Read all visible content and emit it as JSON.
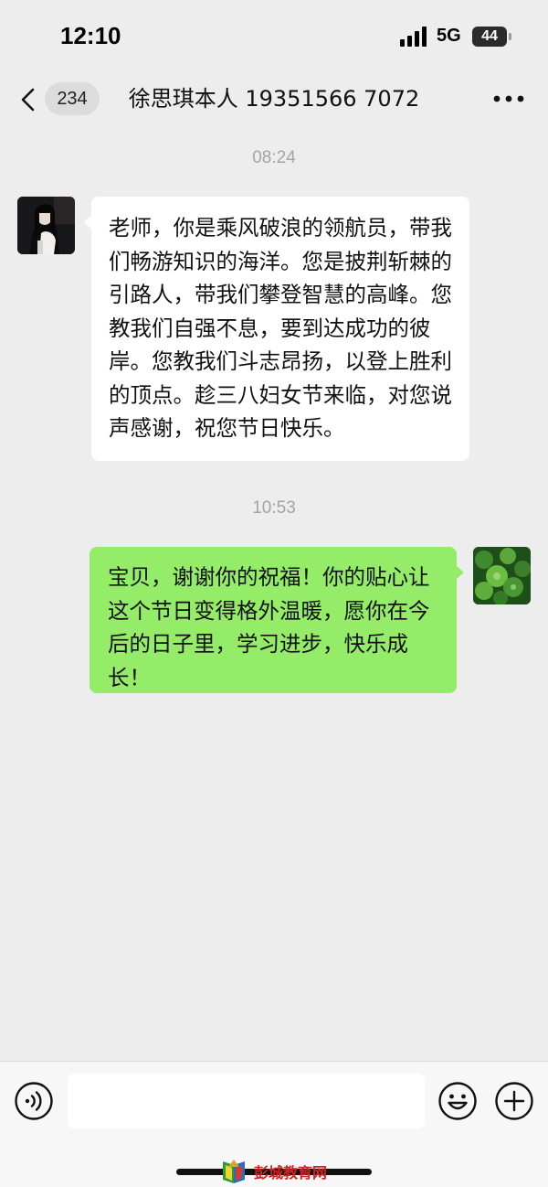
{
  "status_bar": {
    "time": "12:10",
    "network": "5G",
    "battery": "44",
    "battery_level_percent": 44
  },
  "header": {
    "unread_count": "234",
    "title": "徐思琪本人 19351566 7072"
  },
  "messages": [
    {
      "timestamp": "08:24",
      "direction": "incoming",
      "text": "老师，你是乘风破浪的领航员，带我们畅游知识的海洋。您是披荆斩棘的引路人，带我们攀登智慧的高峰。您教我们自强不息，要到达成功的彼岸。您教我们斗志昂扬，以登上胜利的顶点。趁三八妇女节来临，对您说声感谢，祝您节日快乐。"
    },
    {
      "timestamp": "10:53",
      "direction": "outgoing",
      "text": "宝贝，谢谢你的祝福！你的贴心让这个节日变得格外温暖，愿你在今后的日子里，学习进步，快乐成长！"
    }
  ],
  "input_bar": {
    "value": "",
    "placeholder": ""
  },
  "watermark": {
    "text": "彭城教育网"
  },
  "colors": {
    "background": "#ededed",
    "incoming_bubble": "#ffffff",
    "outgoing_bubble": "#95ec69",
    "timestamp": "#a4a4a4"
  },
  "icons": {
    "back": "chevron-left-icon",
    "more": "more-dots-icon",
    "voice": "voice-icon",
    "emoji": "emoji-icon",
    "plus": "plus-icon",
    "signal": "signal-bars-icon",
    "battery": "battery-icon"
  }
}
